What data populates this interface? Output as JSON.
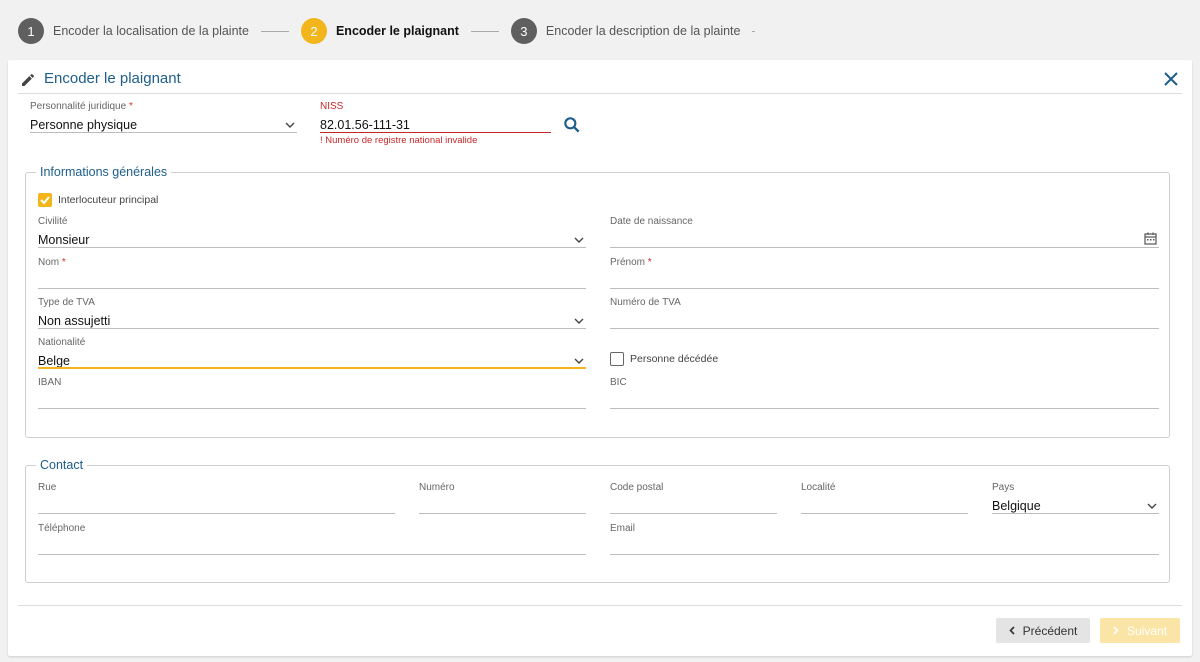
{
  "stepper": {
    "steps": [
      {
        "number": "1",
        "label": "Encoder la localisation de la plainte",
        "state": "done"
      },
      {
        "number": "2",
        "label": "Encoder le plaignant",
        "state": "active"
      },
      {
        "number": "3",
        "label": "Encoder la description de la plainte",
        "state": "done"
      }
    ]
  },
  "card": {
    "title": "Encoder le plaignant",
    "icon": "pencil-icon",
    "close_icon": "close-icon"
  },
  "top_fields": {
    "personnalite": {
      "label": "Personnalité juridique",
      "required": "*",
      "value": "Personne physique"
    },
    "niss": {
      "label": "NISS",
      "value": "82.01.56-111-31",
      "error": "! Numéro de registre national invalide"
    }
  },
  "general": {
    "legend": "Informations générales",
    "interlocuteur": {
      "label": "Interlocuteur principal",
      "checked": true
    },
    "civilite": {
      "label": "Civilité",
      "value": "Monsieur"
    },
    "date_naissance": {
      "label": "Date de naissance",
      "value": ""
    },
    "nom": {
      "label": "Nom",
      "required": "*",
      "value": ""
    },
    "prenom": {
      "label": "Prénom",
      "required": "*",
      "value": ""
    },
    "type_tva": {
      "label": "Type de TVA",
      "value": "Non assujetti"
    },
    "numero_tva": {
      "label": "Numéro de TVA",
      "value": ""
    },
    "nationalite": {
      "label": "Nationalité",
      "value": "Belge"
    },
    "decede": {
      "label": "Personne décédée",
      "checked": false
    },
    "iban": {
      "label": "IBAN",
      "value": ""
    },
    "bic": {
      "label": "BIC",
      "value": ""
    }
  },
  "contact": {
    "legend": "Contact",
    "rue": {
      "label": "Rue",
      "value": ""
    },
    "numero": {
      "label": "Numéro",
      "value": ""
    },
    "code_postal": {
      "label": "Code postal",
      "value": ""
    },
    "localite": {
      "label": "Localité",
      "value": ""
    },
    "pays": {
      "label": "Pays",
      "value": "Belgique"
    },
    "telephone": {
      "label": "Téléphone",
      "value": ""
    },
    "email": {
      "label": "Email",
      "value": ""
    }
  },
  "footer": {
    "prev_label": "Précédent",
    "next_label": "Suivant"
  },
  "colors": {
    "accent": "#f2b51b",
    "title_blue": "#1d5e8a",
    "error": "#c62828",
    "step_done": "#5f5f5f"
  }
}
